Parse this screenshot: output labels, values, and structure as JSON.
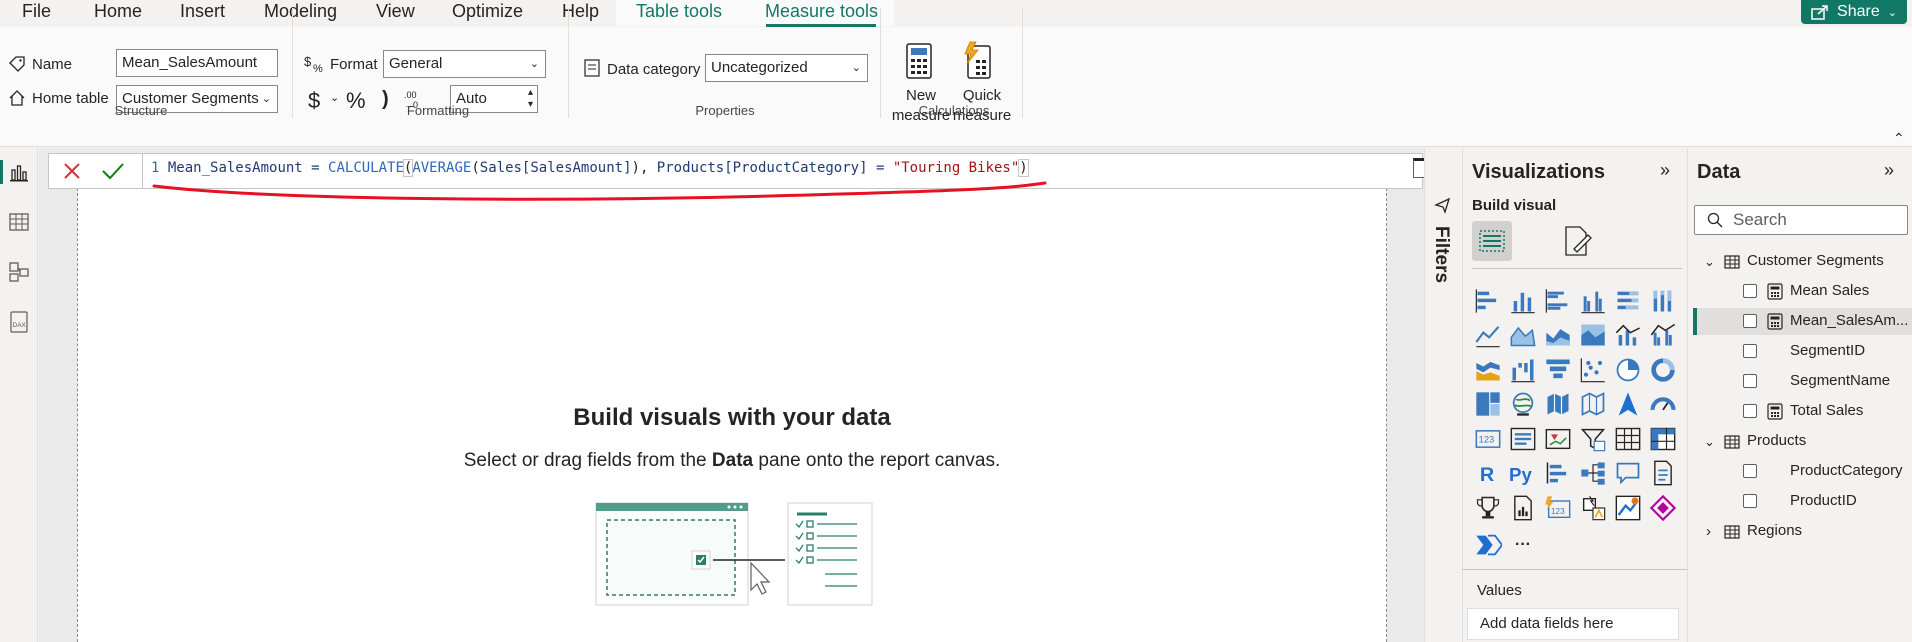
{
  "menu": {
    "file": "File",
    "home": "Home",
    "insert": "Insert",
    "modeling": "Modeling",
    "view": "View",
    "optimize": "Optimize",
    "help": "Help",
    "table_tools": "Table tools",
    "measure_tools": "Measure tools",
    "share": "Share"
  },
  "ribbon": {
    "name_label": "Name",
    "name_value": "Mean_SalesAmount",
    "home_table_label": "Home table",
    "home_table_value": "Customer Segments",
    "structure_label": "Structure",
    "format_label": "Format",
    "format_value": "General",
    "currency_symbol": "$",
    "percent_symbol": "%",
    "comma_symbol": ")",
    "auto_value": "Auto",
    "formatting_label": "Formatting",
    "data_category_label": "Data category",
    "data_category_value": "Uncategorized",
    "properties_label": "Properties",
    "new_measure_line1": "New",
    "new_measure_line2": "measure",
    "quick_measure_line1": "Quick",
    "quick_measure_line2": "measure",
    "calculations_label": "Calculations"
  },
  "formula": {
    "line_number": "1",
    "measure_name": "Mean_SalesAmount",
    "equals": " = ",
    "fn_calculate": "CALCULATE",
    "open1": "(",
    "fn_average": "AVERAGE",
    "open2": "(",
    "arg1": "Sales[SalesAmount]",
    "close2": ")",
    "comma": ", ",
    "arg2": "Products[ProductCategory]",
    "eq2": " = ",
    "string_value": "\"Touring Bikes\"",
    "close1": ")"
  },
  "canvas": {
    "title": "Build visuals with your data",
    "sub_before": "Select or drag fields from the ",
    "sub_bold": "Data",
    "sub_after": " pane onto the report canvas."
  },
  "filters": {
    "label": "Filters"
  },
  "visualizations": {
    "title": "Visualizations",
    "build_visual": "Build visual",
    "r_icon": "R",
    "py_icon": "Py",
    "more_icon": "···",
    "values_label": "Values",
    "values_placeholder": "Add data fields here"
  },
  "data_pane": {
    "title": "Data",
    "search_placeholder": "Search",
    "tables": [
      {
        "name": "Customer Segments",
        "fields": [
          "Mean Sales",
          "Mean_SalesAm...",
          "SegmentID",
          "SegmentName",
          "Total Sales"
        ]
      },
      {
        "name": "Products",
        "fields": [
          "ProductCategory",
          "ProductID"
        ]
      },
      {
        "name": "Regions",
        "fields": []
      }
    ]
  },
  "colors": {
    "accent": "#117865",
    "formula_underline": "#e81123",
    "viz_blue": "#3a79bd"
  }
}
